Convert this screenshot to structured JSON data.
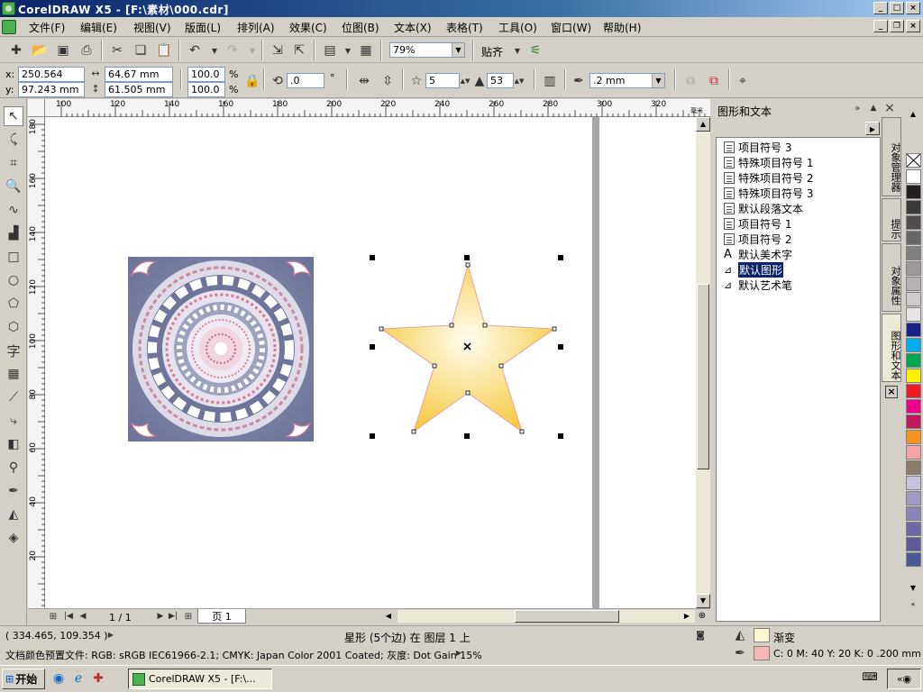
{
  "window": {
    "title": "CorelDRAW X5 - [F:\\素材\\000.cdr]"
  },
  "menu": [
    "文件(F)",
    "编辑(E)",
    "视图(V)",
    "版面(L)",
    "排列(A)",
    "效果(C)",
    "位图(B)",
    "文本(X)",
    "表格(T)",
    "工具(O)",
    "窗口(W)",
    "帮助(H)"
  ],
  "toolbar": {
    "zoom_value": "79%",
    "snap_label": "贴齐"
  },
  "property_bar": {
    "x_label": "x:",
    "x_value": "250.564 mm",
    "y_label": "y:",
    "y_value": "97.243 mm",
    "width_value": "64.67 mm",
    "height_value": "61.505 mm",
    "scale_x": "100.0",
    "scale_y": "100.0",
    "percent": "%",
    "rotation": ".0",
    "degree": "°",
    "points_value": "5",
    "sharpness_value": "53",
    "outline_value": ".2 mm"
  },
  "ruler": {
    "h_ticks": [
      "100",
      "120",
      "140",
      "160",
      "180",
      "200",
      "220",
      "240",
      "260",
      "280",
      "300",
      "320",
      "340"
    ],
    "v_ticks": [
      "180",
      "160",
      "140",
      "120",
      "100",
      "80",
      "60",
      "40",
      "20"
    ],
    "unit": "毫米"
  },
  "page_nav": {
    "page_count": "1 / 1",
    "page_tab": "页 1"
  },
  "dock": {
    "title": "图形和文本",
    "items": [
      "项目符号 3",
      "特殊项目符号 1",
      "特殊项目符号 2",
      "特殊项目符号 3",
      "默认段落文本",
      "项目符号 1",
      "项目符号 2",
      "默认美术字",
      "默认图形",
      "默认艺术笔"
    ],
    "selected_index": 8
  },
  "dock_tabs": [
    "对象管理器",
    "提示",
    "对象属性",
    "图形和文本"
  ],
  "palette": [
    "#ffffff",
    "#231f20",
    "#3a3a3a",
    "#4d4d4d",
    "#666666",
    "#808080",
    "#999999",
    "#b3b3b3",
    "#cccccc",
    "#e6e6e6",
    "#1b1f8a",
    "#00aeef",
    "#00a651",
    "#fff200",
    "#ed1c24",
    "#ec008c",
    "#c2185b",
    "#f7941d",
    "#f5a3a3",
    "#8c7b6b",
    "#c6c3e0",
    "#a09ac8",
    "#8a85b8",
    "#6d68a8",
    "#5c5a9a",
    "#4a5896"
  ],
  "status": {
    "coords": "( 334.465, 109.354 )",
    "selection_info": "星形 (5个边) 在 图层 1 上",
    "color_profile": "文档颜色预置文件: RGB: sRGB IEC61966-2.1; CMYK: Japan Color 2001 Coated; 灰度: Dot Gain 15%",
    "fill_label": "渐变",
    "fill_color": "#fdf5d0",
    "outline_color": "#f4b8b8",
    "outline_label": "C: 0 M: 40 Y: 20 K: 0  .200 mm"
  },
  "taskbar": {
    "start": "开始",
    "task": "CorelDRAW X5 - [F:\\..."
  }
}
